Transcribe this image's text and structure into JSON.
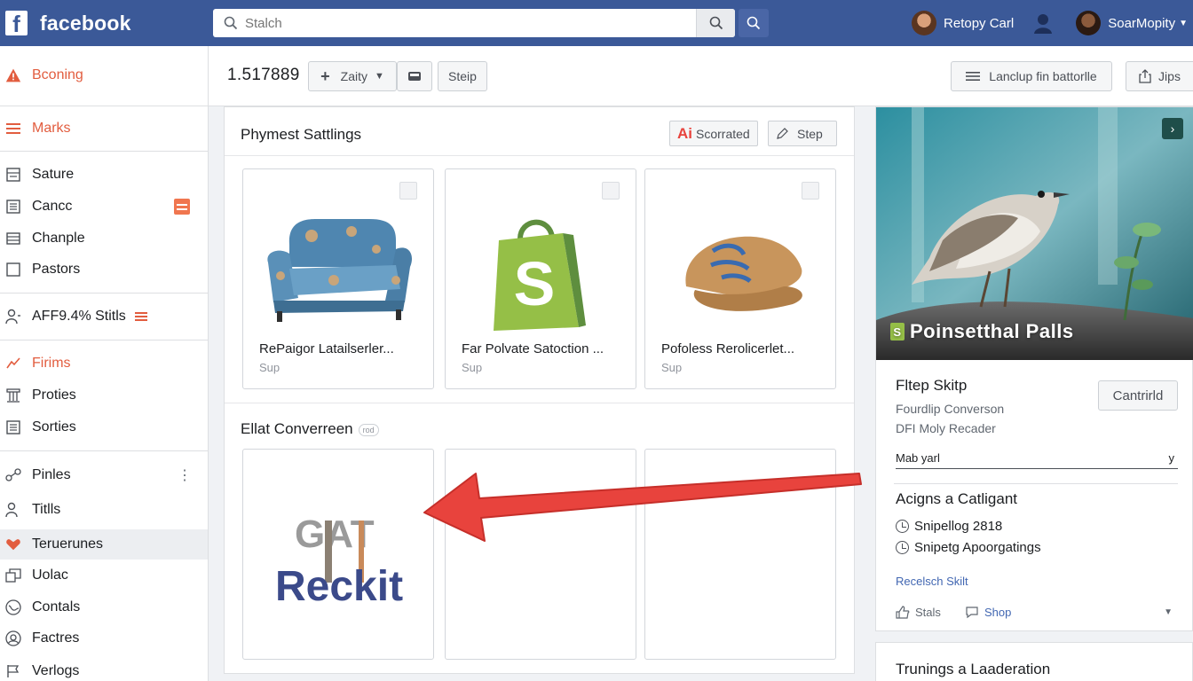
{
  "colors": {
    "brand_blue": "#3b5998",
    "accent_orange": "#e25d3f",
    "link_blue": "#4267b2",
    "arrow_red": "#e8433d"
  },
  "topbar": {
    "logo_letter": "f",
    "brand": "facebook",
    "search_placeholder": "Stalch",
    "user1": "Retopy Carl",
    "user2": "SoarMopity"
  },
  "sidebar": {
    "items": [
      {
        "label": "Bconing",
        "icon": "warning-icon"
      },
      {
        "label": "Marks",
        "icon": "menu-icon"
      },
      {
        "label": "Sature",
        "icon": "list-icon"
      },
      {
        "label": "Cancc",
        "icon": "list-icon"
      },
      {
        "label": "Chanple",
        "icon": "table-icon"
      },
      {
        "label": "Pastors",
        "icon": "square-icon"
      },
      {
        "label": "AFF9.4% Stitls",
        "icon": "users-icon"
      },
      {
        "label": "Firims",
        "icon": "chart-icon"
      },
      {
        "label": "Proties",
        "icon": "building-icon"
      },
      {
        "label": "Sorties",
        "icon": "list-icon"
      },
      {
        "label": "Pinles",
        "icon": "share-icon"
      },
      {
        "label": "Titlls",
        "icon": "people-icon"
      },
      {
        "label": "Teruerunes",
        "icon": "heart-icon"
      },
      {
        "label": "Uolac",
        "icon": "copy-icon"
      },
      {
        "label": "Contals",
        "icon": "globe-icon"
      },
      {
        "label": "Factres",
        "icon": "settings-icon"
      },
      {
        "label": "Verlogs",
        "icon": "flag-icon"
      }
    ]
  },
  "toolbar": {
    "count": "1.517889",
    "zaity_label": "Zaity",
    "step_label": "Steip",
    "setup_label": "Lanclup fin battorlle",
    "jips_label": "Jips"
  },
  "main": {
    "section1_title": "Phymest Sattlings",
    "scorrated_label": "Scorrated",
    "step2_label": "Step",
    "products": [
      {
        "title": "RePaigor Latailserler...",
        "sub": "Sup",
        "image": "armchair"
      },
      {
        "title": "Far Polvate Satoction ...",
        "sub": "Sup",
        "image": "shopify-bag"
      },
      {
        "title": "Pofoless Rerolicerlet...",
        "sub": "Sup",
        "image": "cap"
      }
    ],
    "section2_title": "Ellat Converreen",
    "section2_tag": "rod",
    "logo_top": "GAT",
    "logo_bottom": "Reckit"
  },
  "right": {
    "hero_title": "Poinsetthal Palls",
    "hero_badge": "S",
    "card_title": "Fltep Skitp",
    "card_btn": "Cantrirld",
    "line1": "Fourdlip Converson",
    "line2": "DFI Moly Recader",
    "select_value": "Mab yarl",
    "select_caret": "y",
    "section_title": "Acigns a Catligant",
    "items": [
      "Snipellog 2818",
      "Snipetg Apoorgatings"
    ],
    "link": "Recelsch Skilt",
    "stats_label": "Stals",
    "shop_label": "Shop",
    "bottom_title": "Trunings a Laaderation"
  }
}
